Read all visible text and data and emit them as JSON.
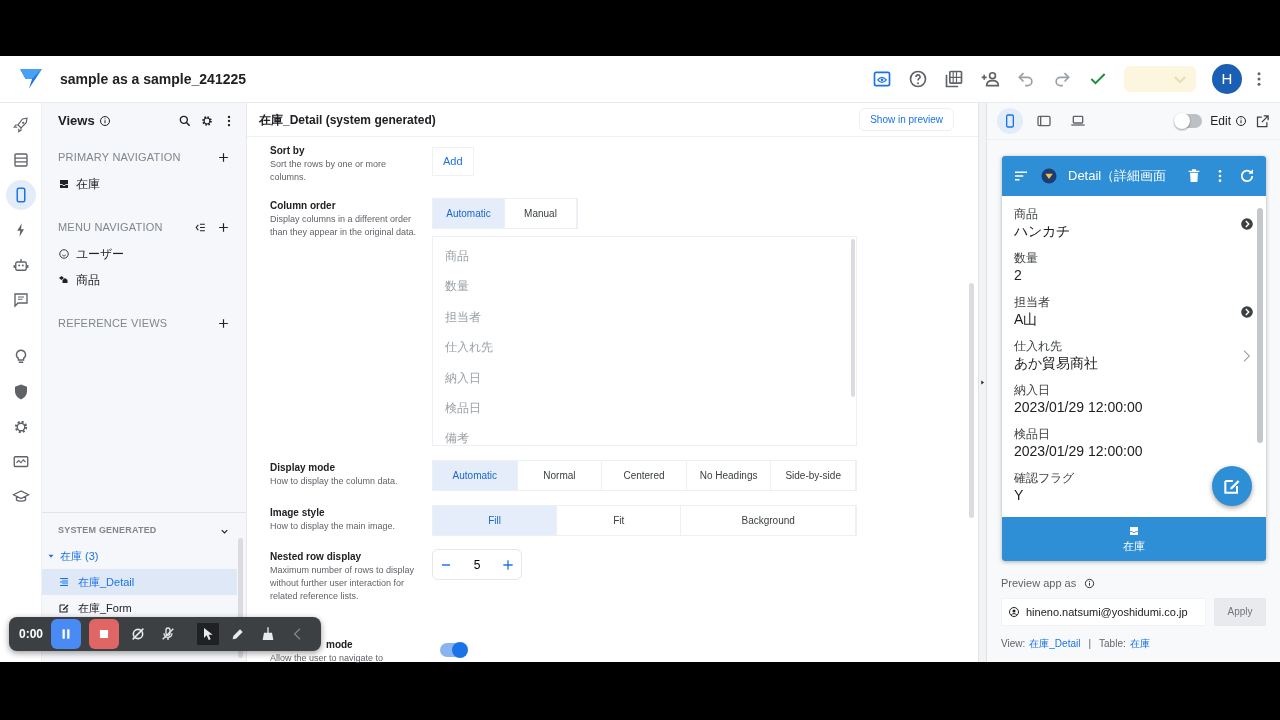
{
  "app": {
    "title": "sample as a sample_241225",
    "save_disabled": true,
    "avatar": "H",
    "actions": [
      {
        "kind": "preview"
      },
      {
        "kind": "help"
      },
      {
        "kind": "library"
      },
      {
        "kind": "share"
      },
      {
        "kind": "undo"
      },
      {
        "kind": "redo"
      },
      {
        "kind": "check"
      }
    ]
  },
  "rail": [
    {
      "kind": "rocket",
      "selected": false
    },
    {
      "kind": "table",
      "selected": false
    },
    {
      "kind": "phone",
      "selected": true
    },
    {
      "kind": "bolt",
      "selected": false
    },
    {
      "kind": "robot",
      "selected": false
    },
    {
      "kind": "chat",
      "selected": false
    },
    {
      "kind": "bulb",
      "selected": false
    },
    {
      "kind": "shield",
      "selected": false
    },
    {
      "kind": "gear",
      "selected": false
    },
    {
      "kind": "monitor",
      "selected": false
    },
    {
      "kind": "school",
      "selected": false
    }
  ],
  "views_panel": {
    "title": "Views",
    "sections": [
      {
        "heading": "PRIMARY NAVIGATION",
        "reorder": false,
        "items": [
          {
            "label": "在庫",
            "kind": "inbox"
          }
        ]
      },
      {
        "heading": "MENU NAVIGATION",
        "reorder": true,
        "items": [
          {
            "label": "ユーザー",
            "kind": "smile"
          },
          {
            "label": "商品",
            "kind": "cubes"
          }
        ]
      },
      {
        "heading": "REFERENCE VIEWS",
        "reorder": false
      }
    ],
    "system_generated": {
      "heading": "SYSTEM GENERATED",
      "expanded": true,
      "groups": [
        {
          "label": "在庫 (3)",
          "expanded": true,
          "children": [
            {
              "label": "在庫_Detail",
              "kind": "detail",
              "selected": true
            },
            {
              "label": "在庫_Form",
              "kind": "form",
              "selected": false
            }
          ]
        }
      ]
    }
  },
  "editor": {
    "title": "在庫_Detail (system generated)",
    "preview_button": "Show in preview",
    "settings": [
      {
        "kind": "button",
        "label": "Sort by",
        "description": "Sort the rows by one or more columns.",
        "button": "Add"
      },
      {
        "kind": "segmented",
        "label": "Column order",
        "description": "Display columns in a different order than they appear in the original data.",
        "options": [
          {
            "label": "Automatic",
            "selected": true
          },
          {
            "label": "Manual",
            "selected": false
          }
        ],
        "list": [
          "商品",
          "数量",
          "担当者",
          "仕入れ先",
          "納入日",
          "検品日",
          "備考"
        ]
      },
      {
        "kind": "segmented",
        "label": "Display mode",
        "description": "How to display the column data.",
        "options": [
          {
            "label": "Automatic",
            "selected": true
          },
          {
            "label": "Normal",
            "selected": false
          },
          {
            "label": "Centered",
            "selected": false
          },
          {
            "label": "No Headings",
            "selected": false
          },
          {
            "label": "Side-by-side",
            "selected": false
          }
        ]
      },
      {
        "kind": "segmented",
        "label": "Image style",
        "description": "How to display the main image.",
        "options": [
          {
            "label": "Fill",
            "selected": true
          },
          {
            "label": "Fit",
            "selected": false
          },
          {
            "label": "Background",
            "selected": false
          }
        ]
      },
      {
        "kind": "stepper",
        "label": "Nested row display",
        "description": "Maximum number of rows to display without further user interaction for related reference lists.",
        "value": "5"
      },
      {
        "kind": "toggle",
        "label": "mode",
        "description": "Allow the user to navigate to",
        "on": true
      }
    ]
  },
  "preview": {
    "devices": [
      {
        "kind": "phone",
        "selected": true
      },
      {
        "kind": "tablet",
        "selected": false
      },
      {
        "kind": "laptop",
        "selected": false
      }
    ],
    "edit_on": false,
    "edit_label": "Edit",
    "app_title": "Detail（詳細画面",
    "fields": [
      {
        "label": "商品",
        "value": "ハンカチ",
        "kind": "reference"
      },
      {
        "label": "数量",
        "value": "2"
      },
      {
        "label": "担当者",
        "value": "A山",
        "kind": "reference"
      },
      {
        "label": "仕入れ先",
        "value": "あか貿易商社",
        "kind": "link"
      },
      {
        "label": "納入日",
        "value": "2023/01/29 12:00:00"
      },
      {
        "label": "検品日",
        "value": "2023/01/29 12:00:00"
      },
      {
        "label": "確認フラグ",
        "value": "Y"
      }
    ],
    "nav": [
      {
        "label": "在庫",
        "selected": true
      }
    ],
    "preview_as_label": "Preview app as",
    "user": "hineno.natsumi@yoshidumi.co.jp",
    "apply": "Apply",
    "apply_disabled": true,
    "footer": {
      "view_label": "View:",
      "view": "在庫_Detail",
      "separator": "|",
      "table_label": "Table:",
      "table": "在庫"
    }
  },
  "recorder": {
    "time": "0:00"
  }
}
